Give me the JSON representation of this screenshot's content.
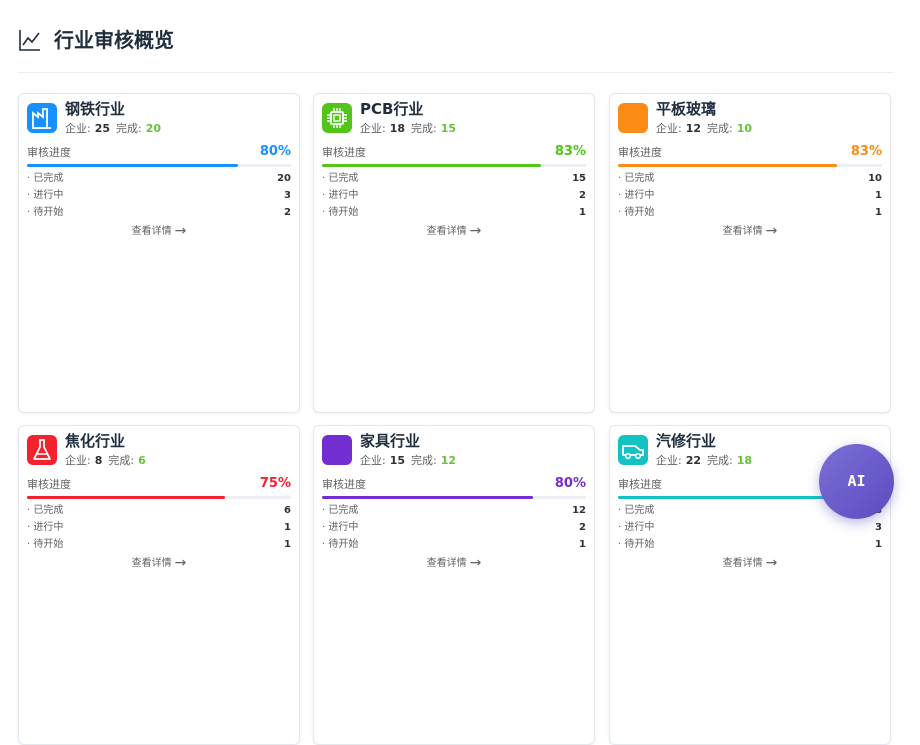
{
  "header": {
    "title": "行业审核概览",
    "icon": "line-chart-icon"
  },
  "labels": {
    "company": "企业:",
    "completed": "完成:",
    "progress": "审核进度",
    "done": "· 已完成",
    "in_progress": "· 进行中",
    "pending": "· 待开始",
    "view_details": "查看详情"
  },
  "cards": [
    {
      "title": "钢铁行业",
      "icon": "factory-icon",
      "color": "#1890ff",
      "icon_bg": "#1890ff",
      "companies": "25",
      "completed": "20",
      "percent": "80%",
      "progress": 80,
      "done": "20",
      "in_progress": "3",
      "pending": "2"
    },
    {
      "title": "PCB行业",
      "icon": "chip-icon",
      "color": "#52c41a",
      "icon_bg": "#52c41a",
      "companies": "18",
      "completed": "15",
      "percent": "83%",
      "progress": 83,
      "done": "15",
      "in_progress": "2",
      "pending": "1"
    },
    {
      "title": "平板玻璃",
      "icon": "glass-icon",
      "color": "#fa8c16",
      "icon_bg": "#fa8c16",
      "companies": "12",
      "completed": "10",
      "percent": "83%",
      "progress": 83,
      "done": "10",
      "in_progress": "1",
      "pending": "1"
    },
    {
      "title": "焦化行业",
      "icon": "flask-icon",
      "color": "#f5222d",
      "icon_bg": "#f5222d",
      "companies": "8",
      "completed": "6",
      "percent": "75%",
      "progress": 75,
      "done": "6",
      "in_progress": "1",
      "pending": "1"
    },
    {
      "title": "家具行业",
      "icon": "furniture-icon",
      "color": "#722ed1",
      "icon_bg": "#722ed1",
      "companies": "15",
      "completed": "12",
      "percent": "80%",
      "progress": 80,
      "done": "12",
      "in_progress": "2",
      "pending": "1"
    },
    {
      "title": "汽修行业",
      "icon": "car-icon",
      "color": "#13c2c2",
      "icon_bg": "#13c2c2",
      "companies": "22",
      "completed": "18",
      "percent": "",
      "progress": 82,
      "done": "8",
      "in_progress": "3",
      "pending": "1"
    }
  ],
  "ai_button": {
    "label": "AI"
  }
}
